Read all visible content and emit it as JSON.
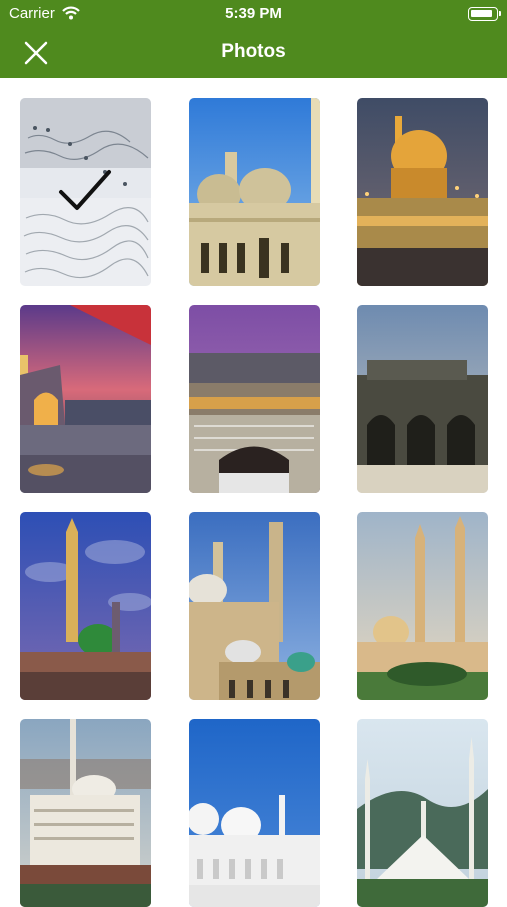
{
  "status_bar": {
    "carrier": "Carrier",
    "time": "5:39 PM"
  },
  "nav": {
    "title": "Photos",
    "close_icon": "close-icon"
  },
  "photos": [
    {
      "name": "quran-page",
      "selected": true
    },
    {
      "name": "mosque-domes-blue-sky",
      "selected": false
    },
    {
      "name": "golden-dome-shrine-night",
      "selected": false
    },
    {
      "name": "shrine-sunset-plaza",
      "selected": false
    },
    {
      "name": "kaaba-crowd",
      "selected": false
    },
    {
      "name": "al-aqsa-arches",
      "selected": false
    },
    {
      "name": "green-dome-night",
      "selected": false
    },
    {
      "name": "mosque-twin-minarets",
      "selected": false
    },
    {
      "name": "desert-mosque-minarets",
      "selected": false
    },
    {
      "name": "istiqlal-mosque",
      "selected": false
    },
    {
      "name": "white-domes-mosque",
      "selected": false
    },
    {
      "name": "faisal-mosque",
      "selected": false
    }
  ],
  "colors": {
    "header": "#4f8a1e",
    "text_on_header": "#ffffff"
  }
}
